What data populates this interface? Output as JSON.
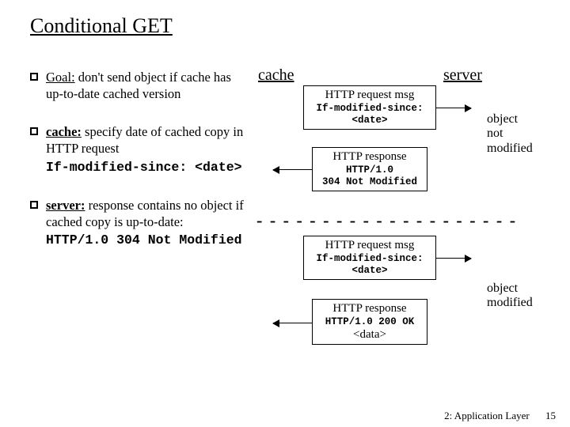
{
  "title": "Conditional GET",
  "bullets": [
    {
      "lead": "Goal:",
      "text": " don't send object if cache has up-to-date cached version"
    },
    {
      "lead": "cache:",
      "text": " specify date of cached copy in HTTP request",
      "code": "If-modified-since: <date>"
    },
    {
      "lead": "server:",
      "text": " response contains  no object if cached copy is up-to-date:",
      "code": "HTTP/1.0 304 Not Modified"
    }
  ],
  "labels": {
    "cache": "cache",
    "server": "server"
  },
  "boxes": {
    "req1_hd": "HTTP request msg",
    "req1_l1": "If-modified-since:",
    "req1_l2": "<date>",
    "resp1_hd": "HTTP response",
    "resp1_l1": "HTTP/1.0",
    "resp1_l2": "304 Not Modified",
    "req2_hd": "HTTP request msg",
    "req2_l1": "If-modified-since:",
    "req2_l2": "<date>",
    "resp2_hd": "HTTP response",
    "resp2_l1": "HTTP/1.0 200 OK",
    "resp2_data": "<data>"
  },
  "notes": {
    "n1_l1": "object",
    "n1_l2": "not",
    "n1_l3": "modified",
    "n2_l1": "object",
    "n2_l2": "modified"
  },
  "dashes": "- - - - - - - - - - - - - - - - - - - -",
  "footer": {
    "chapter": "2: Application Layer",
    "page": "15"
  }
}
